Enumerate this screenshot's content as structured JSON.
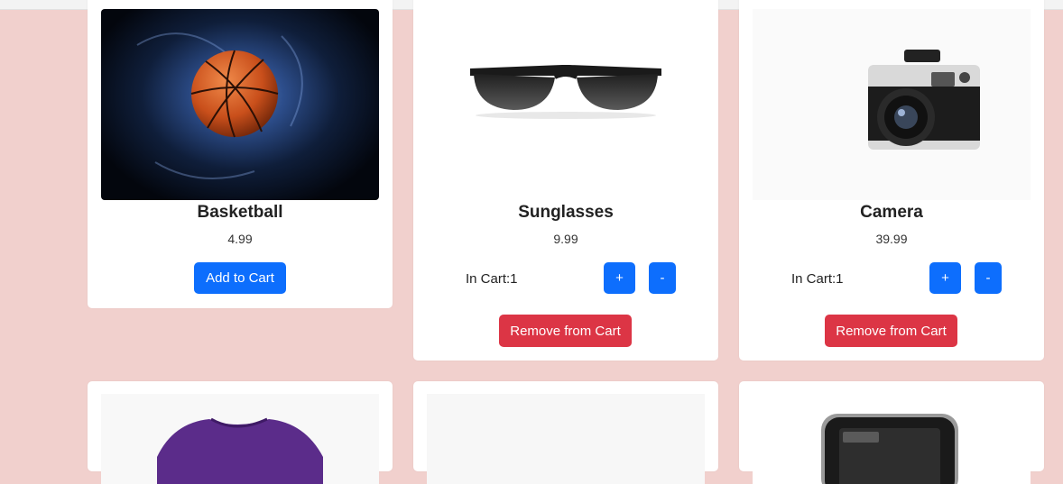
{
  "products": [
    {
      "name": "Basketball",
      "price": "4.99",
      "image_icon": "basketball-image",
      "add_label": "Add to Cart"
    },
    {
      "name": "Sunglasses",
      "price": "9.99",
      "image_icon": "sunglasses-image",
      "in_cart_label": "In Cart:1",
      "plus_label": "+",
      "minus_label": "-",
      "remove_label": "Remove from Cart"
    },
    {
      "name": "Camera",
      "price": "39.99",
      "image_icon": "camera-image",
      "in_cart_label": "In Cart:1",
      "plus_label": "+",
      "minus_label": "-",
      "remove_label": "Remove from Cart"
    }
  ],
  "second_row": [
    {
      "image_icon": "tshirt-image"
    },
    {
      "image_icon": "blank-image"
    },
    {
      "image_icon": "phone-image"
    }
  ],
  "colors": {
    "page_background": "#f1d0cd",
    "primary": "#0d6efd",
    "danger": "#dc3545"
  }
}
